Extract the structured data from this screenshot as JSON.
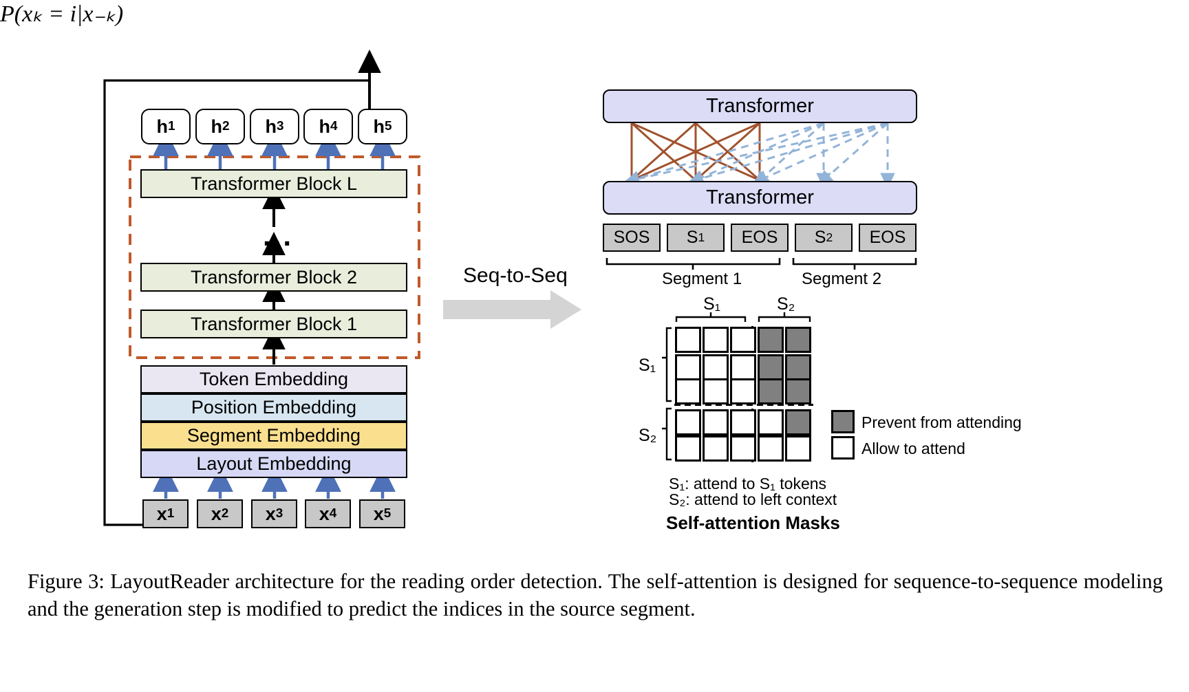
{
  "figure": {
    "caption": "Figure 3: LayoutReader architecture for the reading order detection. The self-attention is designed for sequence-to-sequence modeling and the generation step is modified to predict the indices in the source segment."
  },
  "left_panel": {
    "output_probability": "P(xₖ = i|x₋ₖ)",
    "hidden_states": [
      "h",
      "h",
      "h",
      "h",
      "h"
    ],
    "hidden_subscripts": [
      "1",
      "2",
      "3",
      "4",
      "5"
    ],
    "transformer_blocks": [
      "Transformer Block L",
      "Transformer Block 2",
      "Transformer Block 1"
    ],
    "vertical_dots": "...",
    "embeddings": [
      {
        "label": "Token Embedding",
        "color": "#eae6f2"
      },
      {
        "label": "Position Embedding",
        "color": "#d7e6f0"
      },
      {
        "label": "Segment Embedding",
        "color": "#fadf8e"
      },
      {
        "label": "Layout Embedding",
        "color": "#d6d8f5"
      }
    ],
    "input_tokens": [
      "x",
      "x",
      "x",
      "x",
      "x"
    ],
    "input_subscripts": [
      "1",
      "2",
      "3",
      "4",
      "5"
    ]
  },
  "transition": {
    "label": "Seq-to-Seq"
  },
  "right_panel": {
    "transformer_top": "Transformer",
    "transformer_bottom": "Transformer",
    "sequence_tokens": [
      {
        "text": "SOS",
        "sub": ""
      },
      {
        "text": "S",
        "sub": "1"
      },
      {
        "text": "EOS",
        "sub": ""
      },
      {
        "text": "S",
        "sub": "2"
      },
      {
        "text": "EOS",
        "sub": ""
      }
    ],
    "segment_labels": [
      "Segment 1",
      "Segment 2"
    ],
    "mask": {
      "col_group_labels": [
        "S₁",
        "S₂"
      ],
      "row_group_labels": [
        "S₁",
        "S₂"
      ],
      "rows": [
        [
          "allow",
          "allow",
          "allow",
          "block",
          "block"
        ],
        [
          "allow",
          "allow",
          "allow",
          "block",
          "block"
        ],
        [
          "allow",
          "allow",
          "allow",
          "block",
          "block"
        ],
        [
          "allow",
          "allow",
          "allow",
          "allow",
          "block"
        ],
        [
          "allow",
          "allow",
          "allow",
          "allow",
          "allow"
        ]
      ]
    },
    "legend": [
      {
        "swatch": "blocked",
        "label": "Prevent from attending"
      },
      {
        "swatch": "allow",
        "label": "Allow to attend"
      }
    ],
    "notes": [
      "S₁: attend to S₁ tokens",
      "S₂: attend to left context"
    ],
    "mask_title": "Self-attention Masks"
  },
  "colors": {
    "transformer_fill": "#dcdcf7",
    "block_fill": "#e8eddc",
    "token_fill": "#c8c8c8",
    "blocked_fill": "#808080",
    "dashed_border": "#c05a2a",
    "arrow_blue": "#4f71b8",
    "attn_brown": "#a0522d",
    "attn_blue": "#93b3d8",
    "seq_arrow": "#d4d4d4"
  }
}
